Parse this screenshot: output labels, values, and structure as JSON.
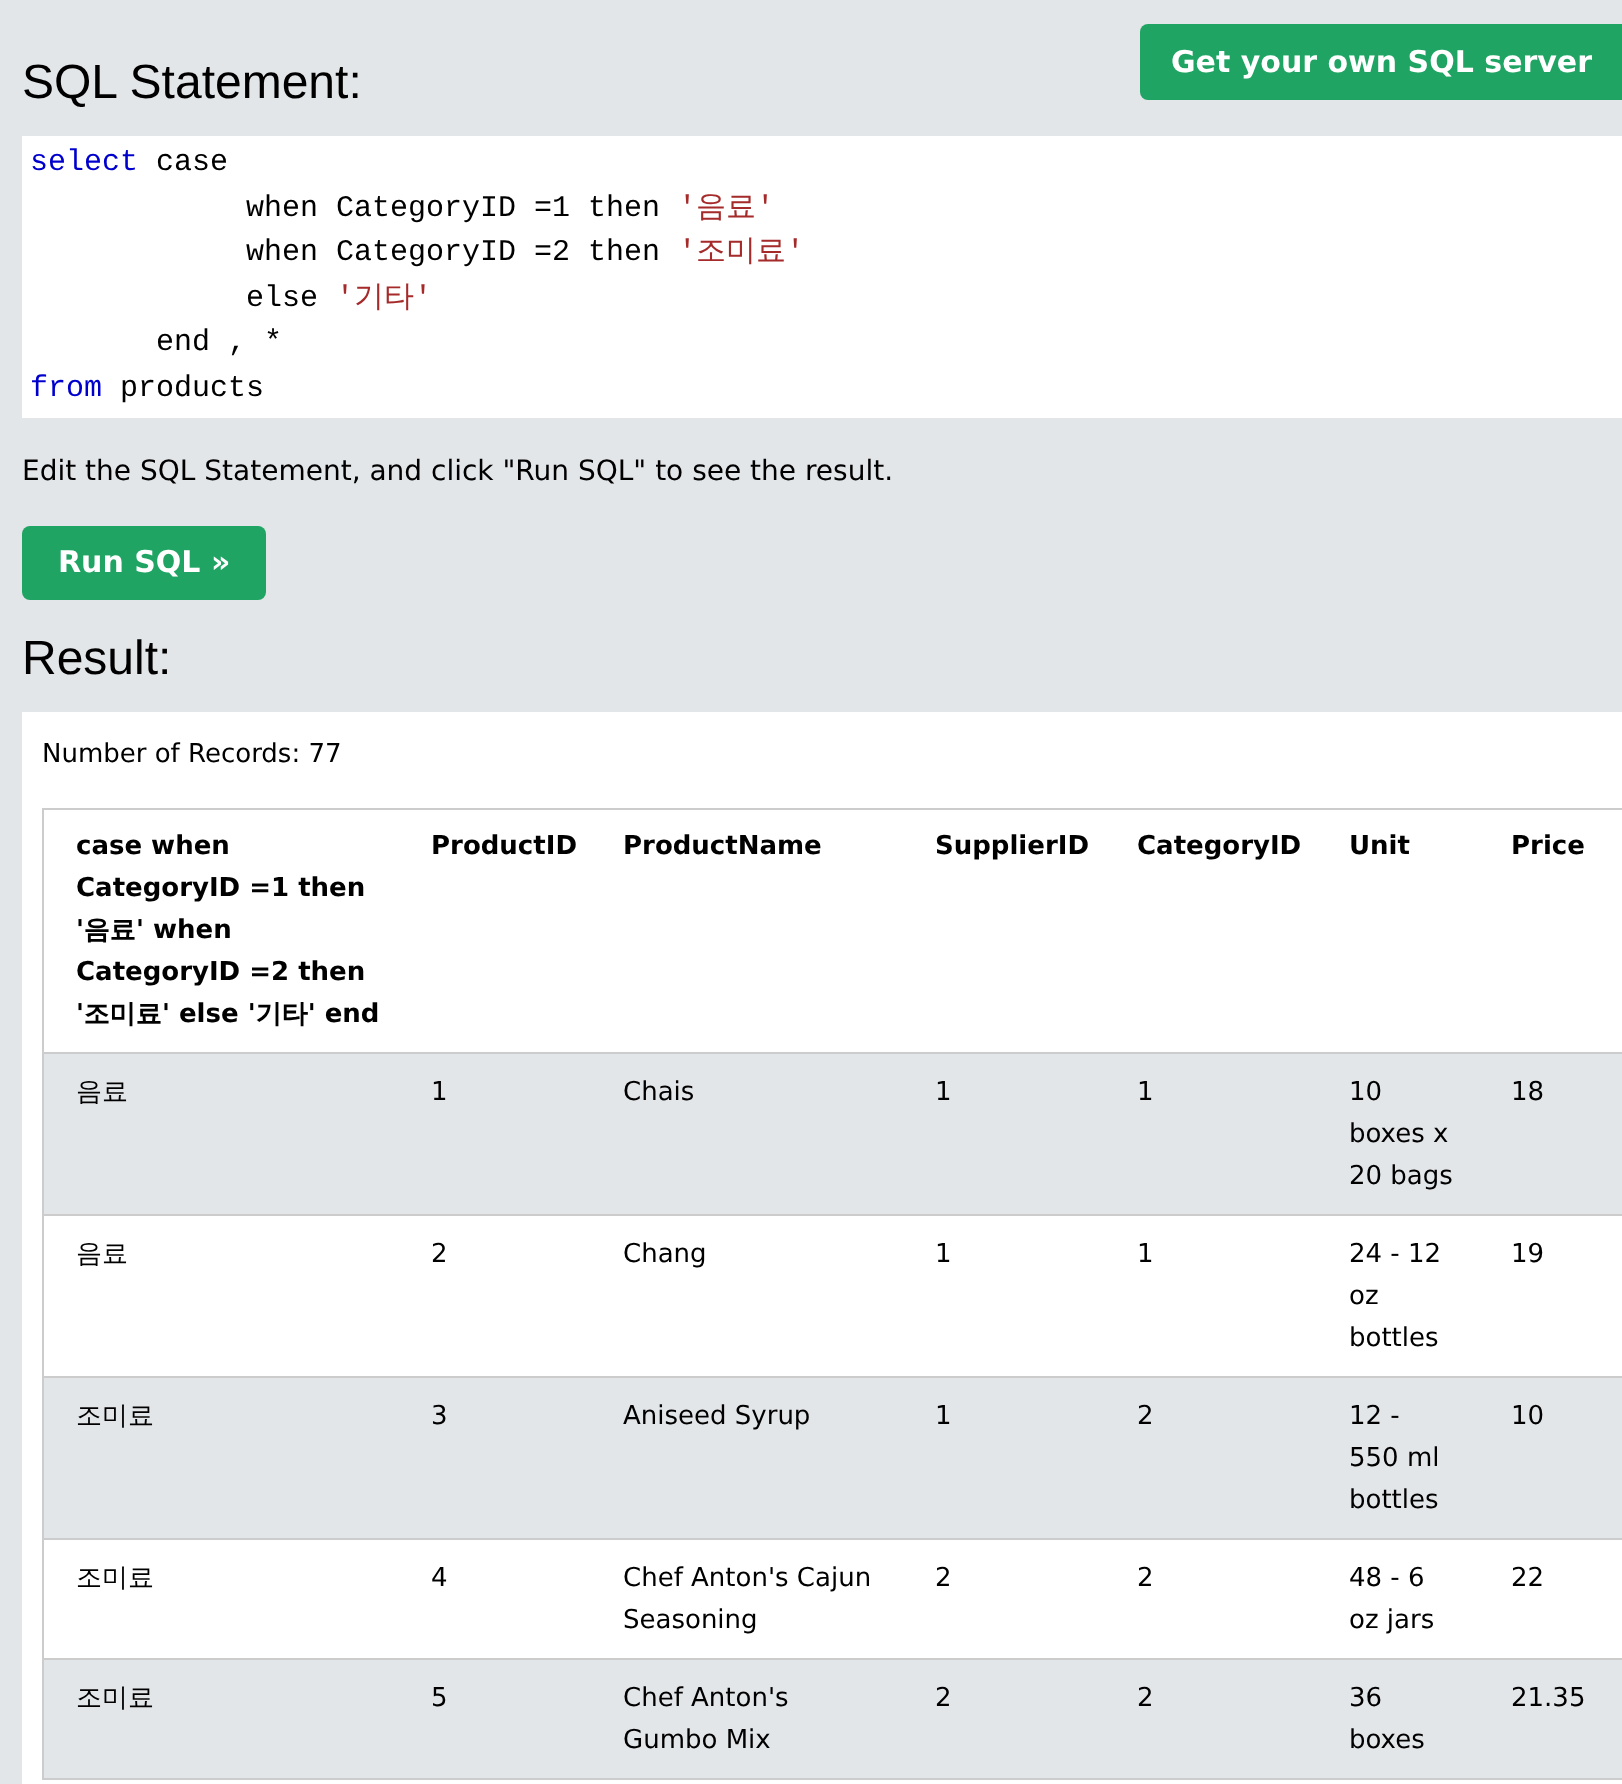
{
  "header": {
    "title": "SQL Statement:",
    "server_button": "Get your own SQL server"
  },
  "code": [
    [
      {
        "kind": "keyword",
        "text": "select"
      },
      {
        "kind": "plain",
        "text": " case"
      }
    ],
    [
      {
        "kind": "plain",
        "text": "            when CategoryID =1 then "
      },
      {
        "kind": "string",
        "text": "'음료'"
      }
    ],
    [
      {
        "kind": "plain",
        "text": "            when CategoryID =2 then "
      },
      {
        "kind": "string",
        "text": "'조미료'"
      }
    ],
    [
      {
        "kind": "plain",
        "text": "            else "
      },
      {
        "kind": "string",
        "text": "'기타'"
      }
    ],
    [
      {
        "kind": "plain",
        "text": "       end , *"
      }
    ],
    [
      {
        "kind": "keyword",
        "text": "from"
      },
      {
        "kind": "plain",
        "text": " products"
      }
    ]
  ],
  "instructions": "Edit the SQL Statement, and click \"Run SQL\" to see the result.",
  "run_button": "Run SQL »",
  "result": {
    "title": "Result:",
    "record_count": "Number of Records: 77",
    "table": {
      "columns": [
        "case when CategoryID =1 then '음료' when CategoryID =2 then '조미료' else '기타' end",
        "ProductID",
        "ProductName",
        "SupplierID",
        "CategoryID",
        "Unit",
        "Price"
      ],
      "rows": [
        [
          "음료",
          "1",
          "Chais",
          "1",
          "1",
          "10 boxes x 20 bags",
          "18"
        ],
        [
          "음료",
          "2",
          "Chang",
          "1",
          "1",
          "24 - 12 oz bottles",
          "19"
        ],
        [
          "조미료",
          "3",
          "Aniseed Syrup",
          "1",
          "2",
          "12 - 550 ml bottles",
          "10"
        ],
        [
          "조미료",
          "4",
          "Chef Anton's Cajun Seasoning",
          "2",
          "2",
          "48 - 6 oz jars",
          "22"
        ],
        [
          "조미료",
          "5",
          "Chef Anton's Gumbo Mix",
          "2",
          "2",
          "36 boxes",
          "21.35"
        ]
      ]
    }
  }
}
